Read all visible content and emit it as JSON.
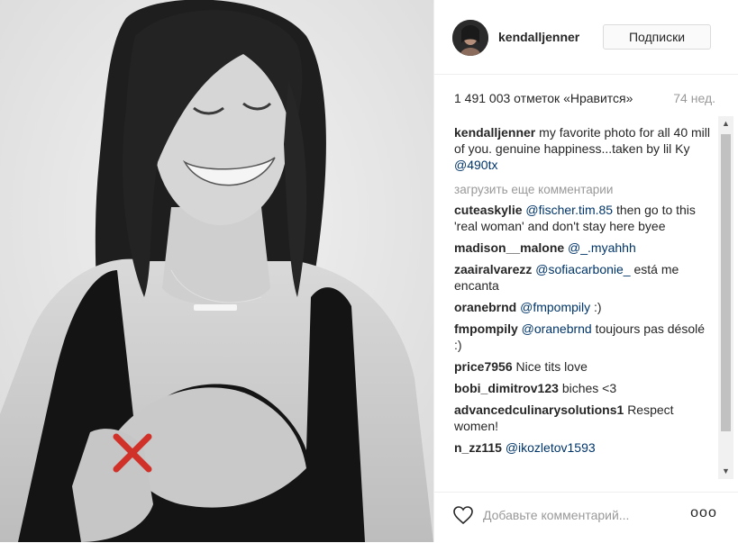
{
  "post": {
    "author": "kendalljenner",
    "follow_label": "Подписки",
    "likes": "1 491 003 отметок «Нравится»",
    "age": "74 нед.",
    "caption": {
      "user": "kendalljenner",
      "text": " my favorite photo for all 40 mill of you. genuine happiness...taken by lil Ky ",
      "mention": "@490tx"
    },
    "load_more": "загрузить еще комментарии",
    "comments": [
      {
        "user": "cuteaskylie",
        "mention": "@fischer.tim.85",
        "text": " then go to this 'real woman' and don't stay here byee"
      },
      {
        "user": "madison__malone",
        "mention": "@_.myahhh",
        "text": ""
      },
      {
        "user": "zaairalvarezz",
        "mention": "@sofiacarbonie_",
        "text": " está me encanta"
      },
      {
        "user": "oranebrnd",
        "mention": "@fmpompily",
        "text": " :)"
      },
      {
        "user": "fmpompily",
        "mention": "@oranebrnd",
        "text": " toujours pas désolé :)"
      },
      {
        "user": "price7956",
        "mention": "",
        "text": "Nice tits love"
      },
      {
        "user": "bobi_dimitrov123",
        "mention": "",
        "text": "biches <3"
      },
      {
        "user": "advancedculinarysolutions1",
        "mention": "",
        "text": "Respect women!"
      },
      {
        "user": "n_zz115",
        "mention": "@ikozletov1593",
        "text": ""
      }
    ],
    "comment_placeholder": "Добавьте комментарий...",
    "more_label": "ooo"
  },
  "colors": {
    "censor_mark": "#d0322a",
    "mention": "#003569",
    "muted": "#999999"
  },
  "icons": {
    "like": "heart-outline-icon",
    "censor": "red-x-mark",
    "scroll_up": "triangle-up-icon",
    "scroll_down": "triangle-down-icon"
  }
}
